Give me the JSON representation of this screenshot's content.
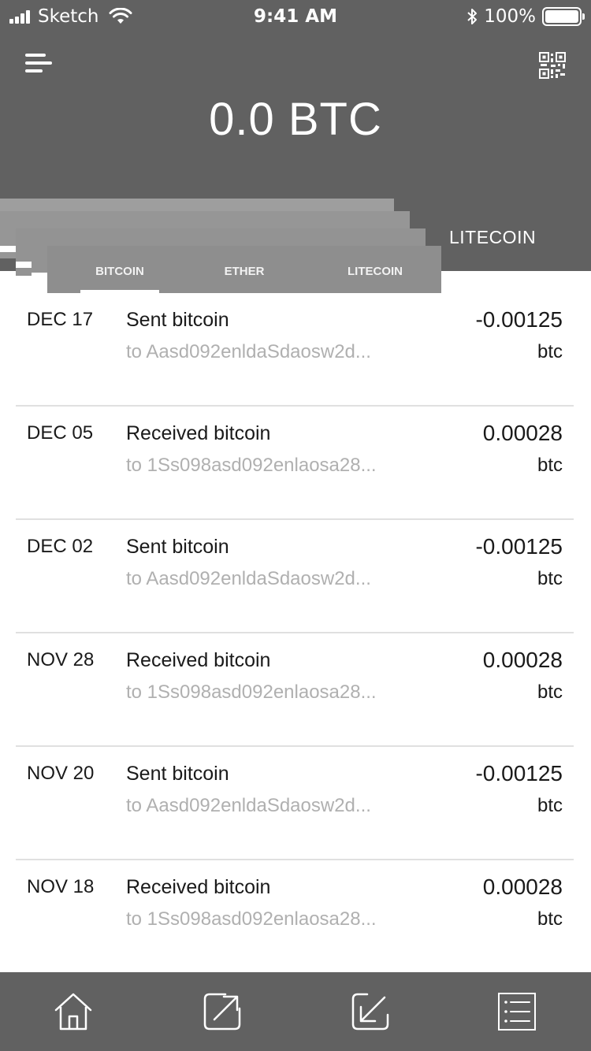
{
  "status_bar": {
    "carrier": "Sketch",
    "time": "9:41 AM",
    "battery": "100%"
  },
  "header": {
    "balance": "0.0 BTC",
    "menu_icon": "hamburger-menu-icon",
    "qr_icon": "qr-code-icon"
  },
  "tabs": {
    "top_label": "LITECOIN",
    "items": [
      {
        "label": "BITCOIN",
        "active": true
      },
      {
        "label": "ETHER",
        "active": false
      },
      {
        "label": "LITECOIN",
        "active": false
      }
    ]
  },
  "transactions": [
    {
      "date": "DEC 17",
      "title": "Sent bitcoin",
      "address": "to Aasd092enldaSdaosw2d...",
      "amount": "-0.00125",
      "unit": "btc"
    },
    {
      "date": "DEC 05",
      "title": "Received bitcoin",
      "address": "to 1Ss098asd092enlaosa28...",
      "amount": "0.00028",
      "unit": "btc"
    },
    {
      "date": "DEC 02",
      "title": "Sent bitcoin",
      "address": "to Aasd092enldaSdaosw2d...",
      "amount": "-0.00125",
      "unit": "btc"
    },
    {
      "date": "NOV 28",
      "title": "Received bitcoin",
      "address": "to 1Ss098asd092enlaosa28...",
      "amount": "0.00028",
      "unit": "btc"
    },
    {
      "date": "NOV 20",
      "title": "Sent bitcoin",
      "address": "to Aasd092enldaSdaosw2d...",
      "amount": "-0.00125",
      "unit": "btc"
    },
    {
      "date": "NOV 18",
      "title": "Received bitcoin",
      "address": "to 1Ss098asd092enlaosa28...",
      "amount": "0.00028",
      "unit": "btc"
    }
  ],
  "bottom_nav": [
    {
      "icon": "home-icon"
    },
    {
      "icon": "send-icon"
    },
    {
      "icon": "receive-icon"
    },
    {
      "icon": "list-icon"
    }
  ],
  "colors": {
    "header_bg": "#616161",
    "tab_bg": "#8e8e8e",
    "divider": "#e0e0e0",
    "address_text": "#b0b0b0"
  }
}
